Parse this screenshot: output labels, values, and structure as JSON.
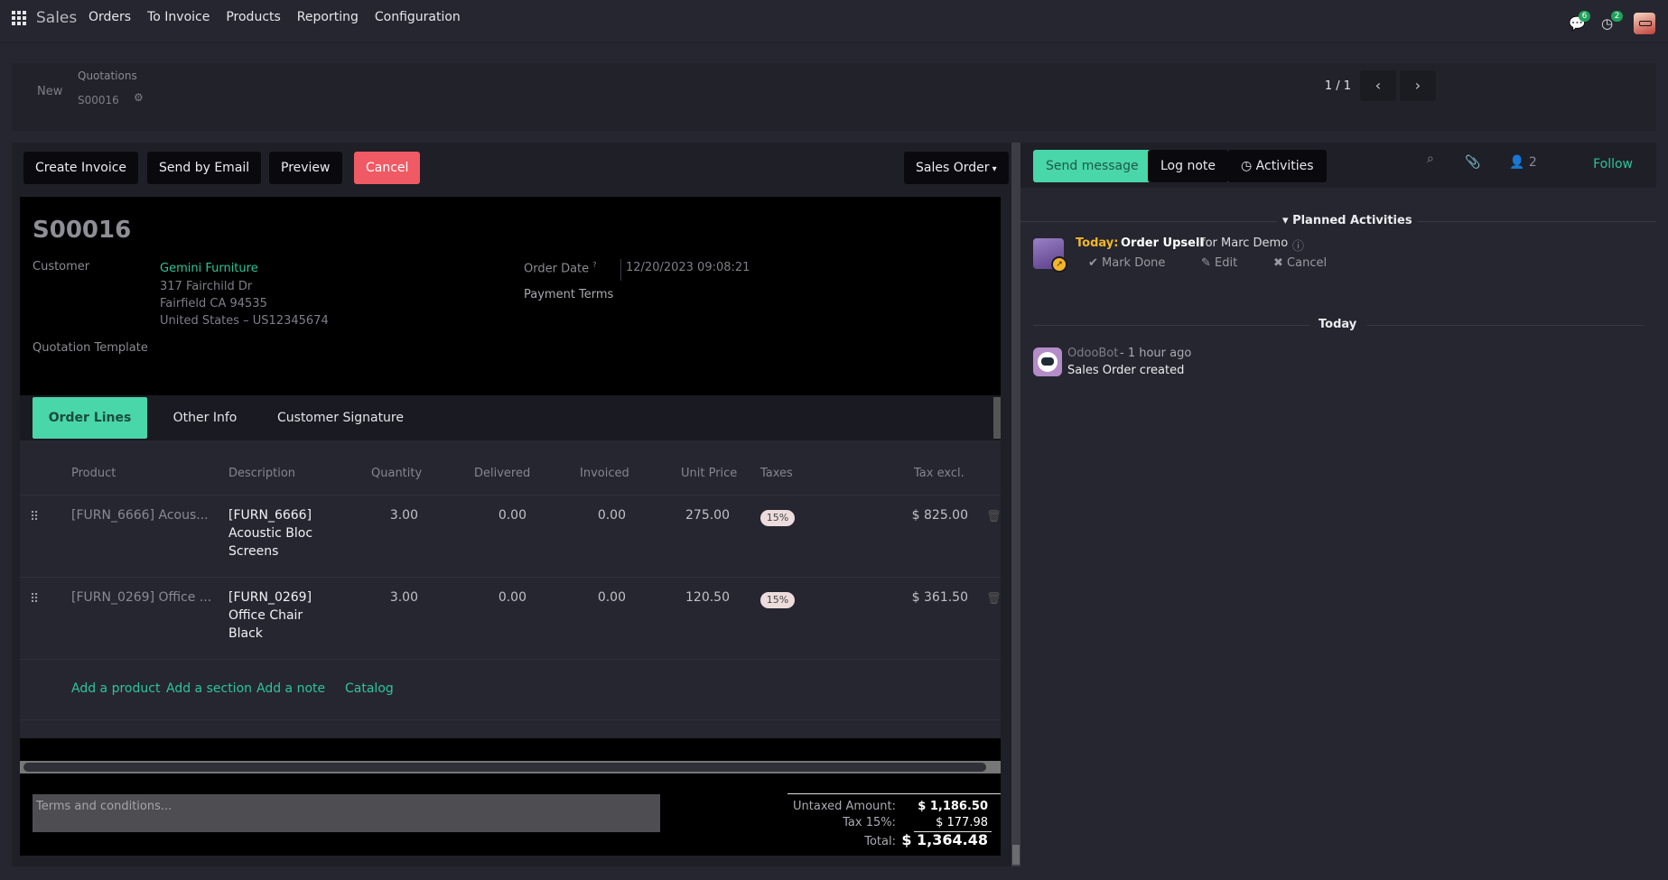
{
  "nav": {
    "brand": "Sales",
    "menu": [
      "Orders",
      "To Invoice",
      "Products",
      "Reporting",
      "Configuration"
    ],
    "messages_badge": "6",
    "activities_badge": "2"
  },
  "control_panel": {
    "new_label": "New",
    "breadcrumb_parent": "Quotations",
    "breadcrumb_current": "S00016",
    "pager": "1 / 1"
  },
  "statusbar": {
    "create_invoice": "Create Invoice",
    "send_email": "Send by Email",
    "preview": "Preview",
    "cancel": "Cancel",
    "status": "Sales Order"
  },
  "form": {
    "title": "S00016",
    "customer_label": "Customer",
    "customer_name": "Gemini Furniture",
    "address_line1": "317 Fairchild Dr",
    "address_line2": "Fairfield CA 94535",
    "address_line3": "United States – US12345674",
    "quotation_template_label": "Quotation Template",
    "order_date_label": "Order Date",
    "order_date_help": "?",
    "order_date_value": "12/20/2023 09:08:21",
    "payment_terms_label": "Payment Terms"
  },
  "tabs": [
    "Order Lines",
    "Other Info",
    "Customer Signature"
  ],
  "order_lines": {
    "headers": {
      "product": "Product",
      "description": "Description",
      "quantity": "Quantity",
      "delivered": "Delivered",
      "invoiced": "Invoiced",
      "unit_price": "Unit Price",
      "taxes": "Taxes",
      "tax_excl": "Tax excl."
    },
    "rows": [
      {
        "product": "[FURN_6666] Acous...",
        "desc1": "[FURN_6666]",
        "desc2": "Acoustic Bloc",
        "desc3": "Screens",
        "quantity": "3.00",
        "delivered": "0.00",
        "invoiced": "0.00",
        "unit_price": "275.00",
        "tax": "15%",
        "subtotal": "$ 825.00"
      },
      {
        "product": "[FURN_0269] Office ...",
        "desc1": "[FURN_0269]",
        "desc2": "Office Chair",
        "desc3": "Black",
        "quantity": "3.00",
        "delivered": "0.00",
        "invoiced": "0.00",
        "unit_price": "120.50",
        "tax": "15%",
        "subtotal": "$ 361.50"
      }
    ],
    "add_product": "Add a product",
    "add_section": "Add a section",
    "add_note": "Add a note",
    "catalog": "Catalog"
  },
  "footer": {
    "terms_placeholder": "Terms and conditions...",
    "untaxed_label": "Untaxed Amount:",
    "untaxed_value": "$ 1,186.50",
    "tax_label": "Tax 15%:",
    "tax_value": "$ 177.98",
    "total_label": "Total:",
    "total_value": "$ 1,364.48"
  },
  "chatter": {
    "send_message": "Send message",
    "log_note": "Log note",
    "activities": "Activities",
    "followers_count": "2",
    "follow": "Follow",
    "planned_title": "Planned Activities",
    "activity_today": "Today:",
    "activity_name": "Order Upsell",
    "activity_for": "for Marc Demo",
    "mark_done": "Mark Done",
    "edit": "Edit",
    "cancel": "Cancel",
    "today_separator": "Today",
    "message_author": "OdooBot",
    "message_time": "- 1 hour ago",
    "message_body": "Sales Order created"
  },
  "colors": {
    "accent": "#49d6a8",
    "link": "#2ec49a",
    "danger": "#f05a64",
    "today_highlight": "#f3b62a"
  }
}
